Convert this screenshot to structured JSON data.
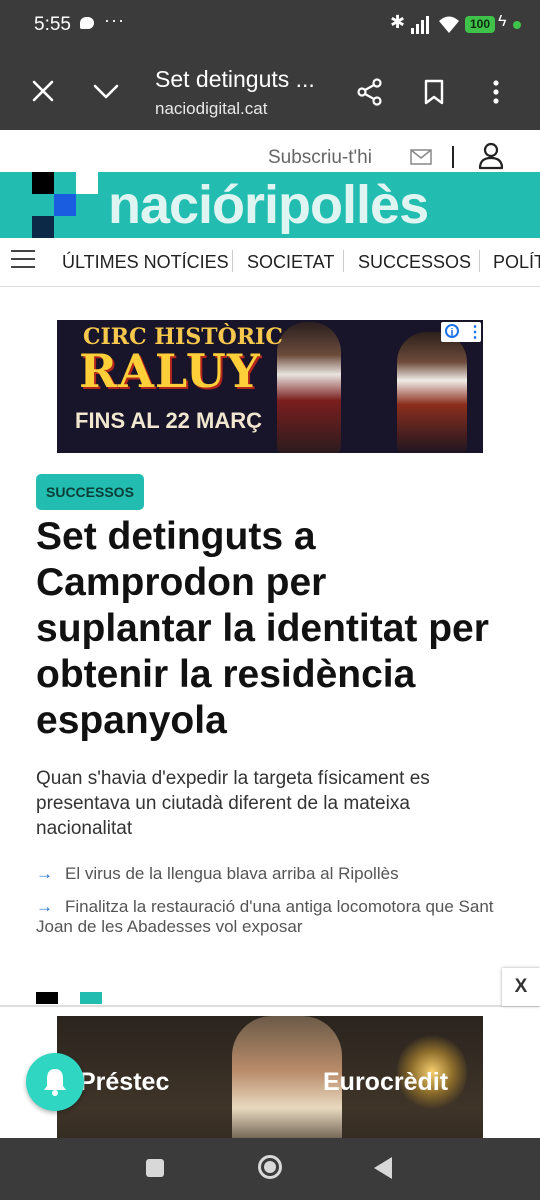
{
  "status_bar": {
    "time": "5:55",
    "dots": "···",
    "battery": "100"
  },
  "browser": {
    "title": "Set detinguts ...",
    "url": "naciodigital.cat",
    "icons": [
      "close-icon",
      "chevron-down-icon",
      "share-icon",
      "bookmark-icon",
      "more-vert-icon"
    ]
  },
  "site": {
    "subscribe_label": "Subscriu-t'hi",
    "brand": "nacióripollès",
    "accent_color": "#22bdb0",
    "nav": [
      "ÚLTIMES NOTÍCIES",
      "SOCIETAT",
      "SUCCESSOS",
      "POLÍT"
    ]
  },
  "ad_top": {
    "line1": "CIRC HISTÒRIC",
    "line2": "RALUY",
    "line3": "FINS AL 22 MARÇ"
  },
  "article": {
    "category": "SUCCESSOS",
    "headline": "Set detinguts a Camprodon per suplantar la identitat per obtenir la residència espanyola",
    "lead": "Quan s'havia d'expedir la targeta físicament es presentava un ciutadà diferent de la mateixa nacionalitat",
    "related": [
      "El virus de la llengua blava arriba al Ripollès",
      "Finalitza la restauració d'una antiga locomotora que Sant Joan de les Abadesses vol exposar"
    ]
  },
  "ad_bottom": {
    "close_label": "X",
    "left_text": "Préstec",
    "right_text": "Eurocrèdit"
  }
}
